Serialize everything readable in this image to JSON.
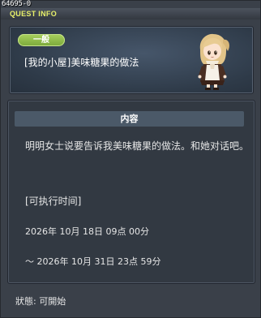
{
  "window": {
    "id_tag": "64695-0",
    "title": "QUEST INFO"
  },
  "quest": {
    "category": "一般",
    "title": "[我的小屋]美味糖果的做法"
  },
  "content": {
    "header": "内容",
    "description": "明明女士说要告诉我美味糖果的做法。和她对话吧。",
    "time_label": "[可执行时间]",
    "time_start": "2026年  10月  18日  09点  00分",
    "time_end": "～  2026年  10月  31日  23点  59分"
  },
  "status": "狀態:  可開始",
  "colors": {
    "title_text": "#e8f06a",
    "badge_green": "#8fbc46",
    "section_header": "#4b5968"
  },
  "icons": {
    "npc": "npc-girl-portrait"
  }
}
